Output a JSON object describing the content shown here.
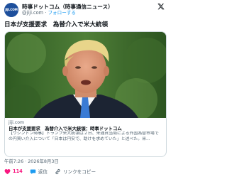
{
  "account": {
    "display_name": "時事ドットコム（時事通信ニュース）",
    "handle": "@jiji.com",
    "separator": "·",
    "follow_label": "フォローする",
    "avatar_text": "JIJI.COM"
  },
  "tweet": {
    "text": "日本が支援要求　為替介入で米大統領"
  },
  "card": {
    "domain": "jiji.com",
    "title": "日本が支援要求　為替介入で米大統領：時事ドットコム",
    "description": "【ワシントン時事】トランプ米大統領は２日、米通貨当局による外国為替市場での円買い介入について「日本は円安で、助けを求めていた」と述べた。米..."
  },
  "meta": {
    "timestamp": "午前7:26 · 2026年8月3日"
  },
  "actions": {
    "like_count": "114",
    "reply_label": "返信",
    "copy_label": "リンクをコピー"
  },
  "colors": {
    "accent": "#1d9bf0",
    "like": "#f91880",
    "muted": "#536471",
    "avatar_bg": "#1d4f9c"
  }
}
